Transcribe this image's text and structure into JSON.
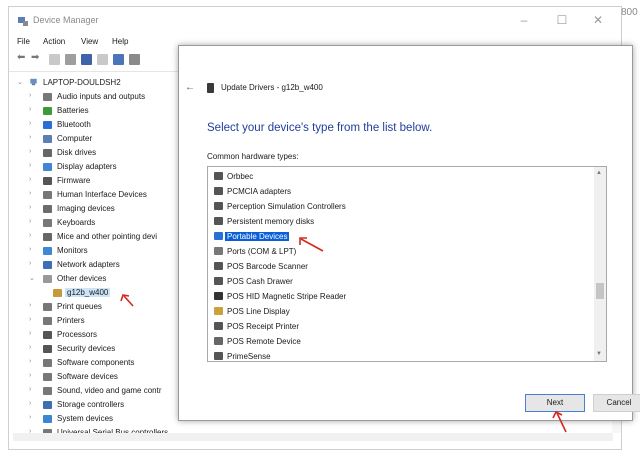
{
  "device_manager": {
    "title": "Device Manager",
    "window_controls": {
      "minimize": "–",
      "maximize": "☐",
      "close": "✕"
    },
    "corner_label": "800",
    "menu": [
      "File",
      "Action",
      "View",
      "Help"
    ],
    "tree": {
      "root": "LAPTOP-DOULDSH2",
      "items": [
        "Audio inputs and outputs",
        "Batteries",
        "Bluetooth",
        "Computer",
        "Disk drives",
        "Display adapters",
        "Firmware",
        "Human Interface Devices",
        "Imaging devices",
        "Keyboards",
        "Mice and other pointing devi",
        "Monitors",
        "Network adapters",
        "Other devices",
        "g12b_w400",
        "Print queues",
        "Printers",
        "Processors",
        "Security devices",
        "Software components",
        "Software devices",
        "Sound, video and game contr",
        "Storage controllers",
        "System devices",
        "Universal Serial Bus controllers"
      ]
    }
  },
  "dialog": {
    "back": "←",
    "title": "Update Drivers - g12b_w400",
    "heading": "Select your device's type from the list below.",
    "list_label": "Common hardware types:",
    "hardware_types": [
      "Orbbec",
      "PCMCIA adapters",
      "Perception Simulation Controllers",
      "Persistent memory disks",
      "Portable Devices",
      "Ports (COM & LPT)",
      "POS Barcode Scanner",
      "POS Cash Drawer",
      "POS HID Magnetic Stripe Reader",
      "POS Line Display",
      "POS Receipt Printer",
      "POS Remote Device",
      "PrimeSense"
    ],
    "selected_type": "Portable Devices",
    "next": "Next",
    "cancel": "Cancel"
  },
  "colors": {
    "accent": "#0a5fd6",
    "heading": "#1e3f9e",
    "annotation_arrow": "#d22a1f"
  }
}
